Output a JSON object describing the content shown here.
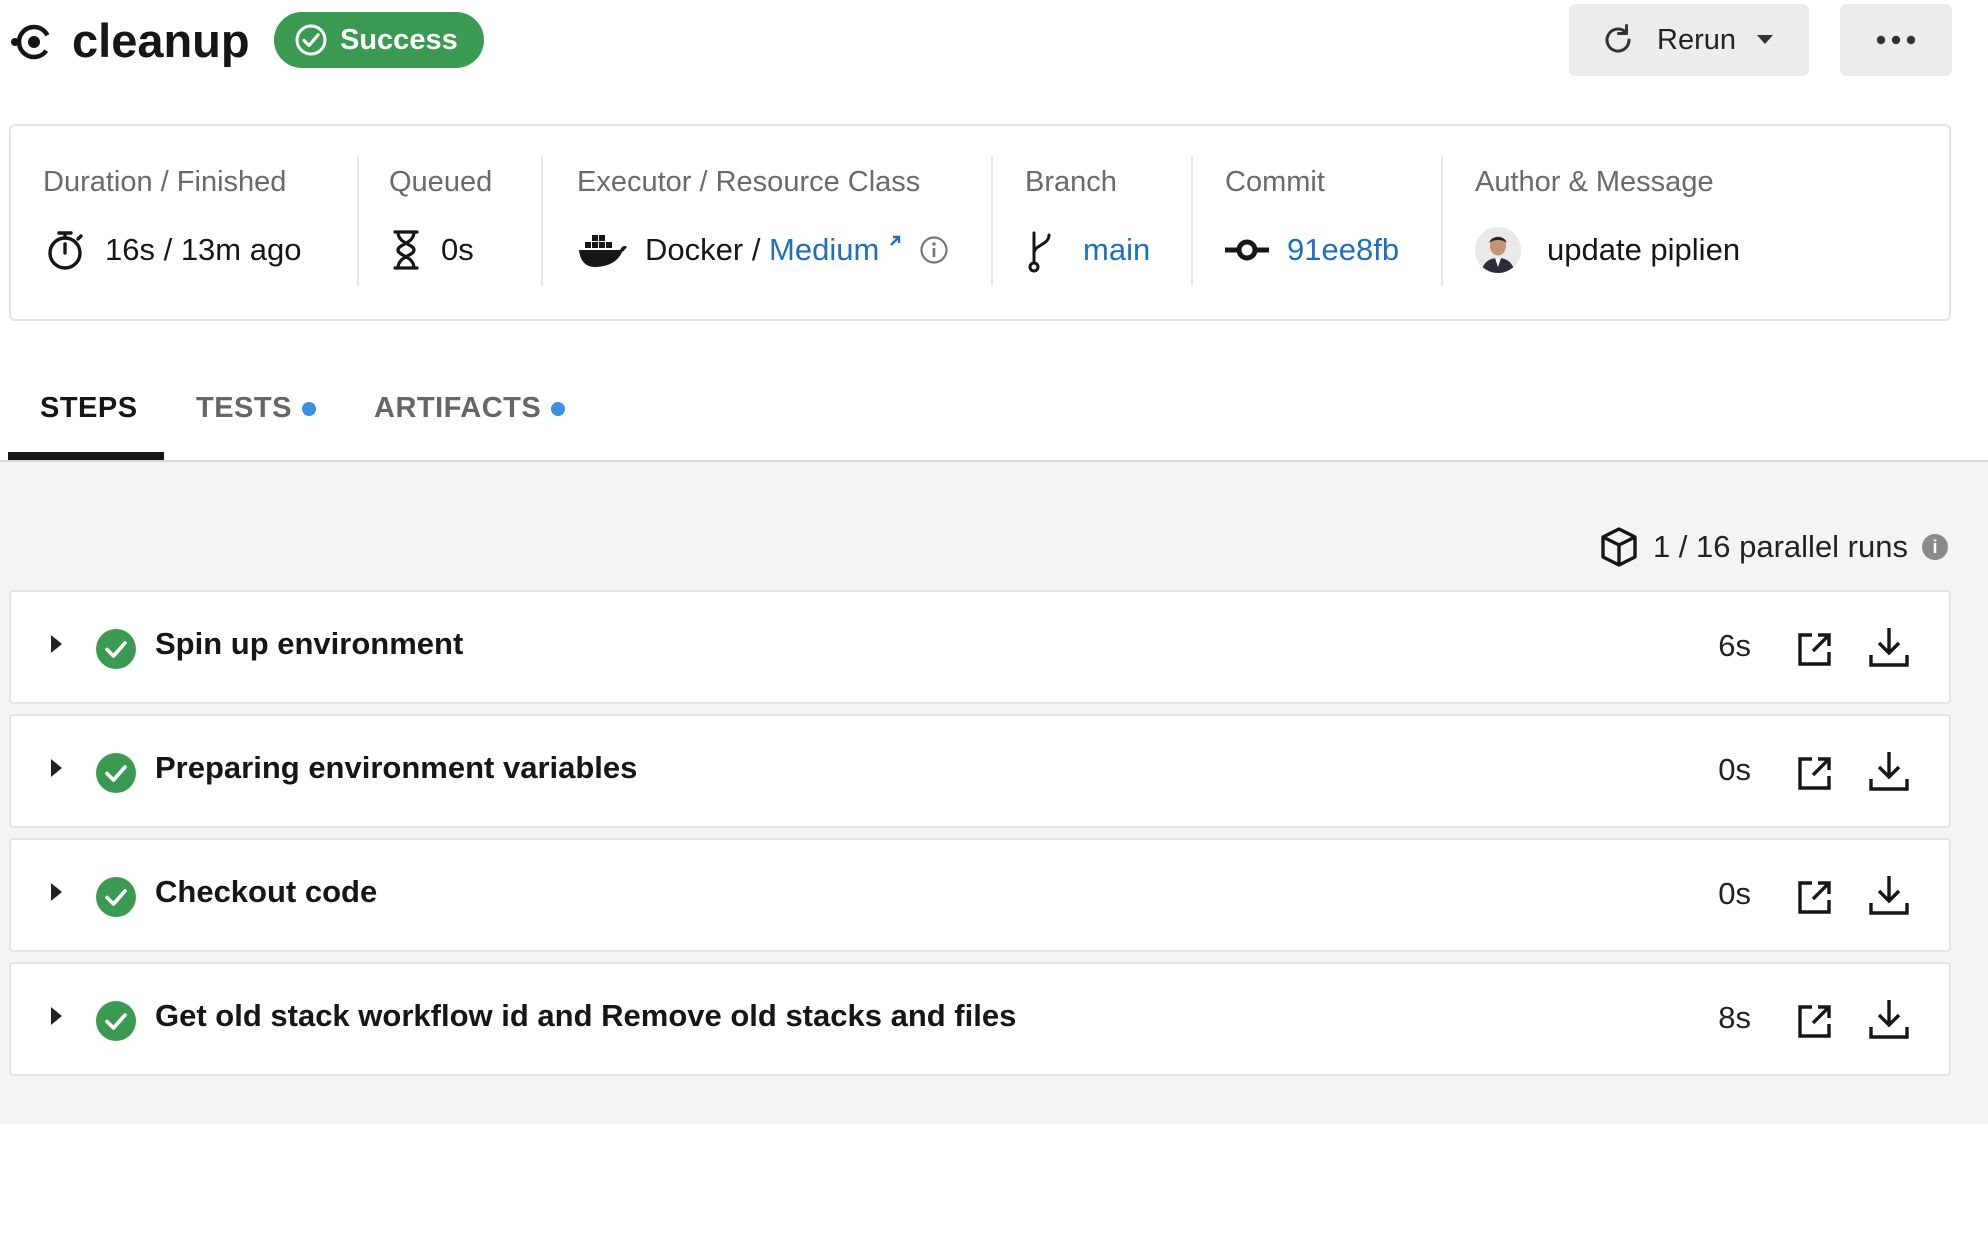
{
  "header": {
    "job_name": "cleanup",
    "status": "Success",
    "rerun_label": "Rerun"
  },
  "info": {
    "duration": {
      "label": "Duration / Finished",
      "value": "16s / 13m ago"
    },
    "queued": {
      "label": "Queued",
      "value": "0s"
    },
    "executor": {
      "label": "Executor / Resource Class",
      "executor": "Docker",
      "resource_class": "Medium"
    },
    "branch": {
      "label": "Branch",
      "value": "main"
    },
    "commit": {
      "label": "Commit",
      "value": "91ee8fb"
    },
    "author": {
      "label": "Author & Message",
      "message": "update piplien"
    }
  },
  "tabs": [
    {
      "label": "STEPS",
      "active": true
    },
    {
      "label": "TESTS"
    },
    {
      "label": "ARTIFACTS"
    }
  ],
  "parallel_runs": "1 / 16 parallel runs",
  "steps": [
    {
      "name": "Spin up environment",
      "duration": "6s"
    },
    {
      "name": "Preparing environment variables",
      "duration": "0s"
    },
    {
      "name": "Checkout code",
      "duration": "0s"
    },
    {
      "name": "Get old stack workflow id and Remove old stacks and files",
      "duration": "8s"
    }
  ],
  "colors": {
    "success": "#3b9a52",
    "link": "#1f6fbf",
    "tab_dot": "#3d8fe0"
  }
}
